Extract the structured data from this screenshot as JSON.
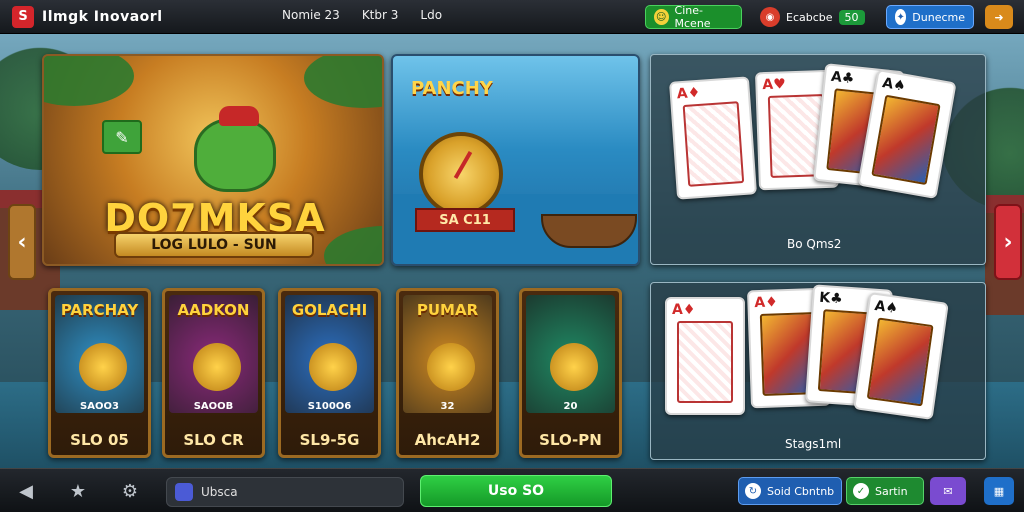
{
  "app": {
    "logo_glyph": "S",
    "title": "Ilmgk Inovaorl"
  },
  "top_links": [
    "Nomie 23",
    "Ktbr 3",
    "Ldo"
  ],
  "top_right": {
    "green_pill": "Cine-Mcene",
    "coins_label": "Ecabcbe",
    "coins_count": "50",
    "blue_pill": "Dunecme"
  },
  "hero": {
    "title": "DO7MKSA",
    "banner": "LOG LULO - SUN"
  },
  "fishing": {
    "top": "PANCHY",
    "ribbon": "SA C11"
  },
  "card_panels": {
    "top_label": "Bo Qms2",
    "bottom_label": "Stags1ml",
    "top_cards": [
      {
        "rank": "A",
        "suit": "♦",
        "color": "red",
        "face": false
      },
      {
        "rank": "A",
        "suit": "♥",
        "color": "red",
        "face": false
      },
      {
        "rank": "A",
        "suit": "♣",
        "color": "blk",
        "face": true
      },
      {
        "rank": "A",
        "suit": "♠",
        "color": "blk",
        "face": true
      }
    ],
    "bottom_cards": [
      {
        "rank": "A",
        "suit": "♦",
        "color": "red",
        "face": false
      },
      {
        "rank": "A",
        "suit": "♦",
        "color": "red",
        "face": true
      },
      {
        "rank": "K",
        "suit": "♣",
        "color": "blk",
        "face": true
      },
      {
        "rank": "A",
        "suit": "♠",
        "color": "blk",
        "face": true
      }
    ]
  },
  "tiles": [
    {
      "name": "PARCHAY",
      "sub": "SAOO3",
      "price": "SLO 05",
      "bg": "#2f8fc4"
    },
    {
      "name": "AADKON",
      "sub": "SAOOB",
      "price": "SLO CR",
      "bg": "#8a2a7a"
    },
    {
      "name": "GOLACHI",
      "sub": "S100O6",
      "price": "SL9-5G",
      "bg": "#2c6fc0"
    },
    {
      "name": "PUMAR",
      "sub": "32",
      "price": "AhcAH2",
      "bg": "#d08a22"
    },
    {
      "name": "",
      "sub": "20",
      "price": "SLO-PN",
      "bg": "#1f8a64"
    }
  ],
  "bottom": {
    "search_label": "Ubsca",
    "play_label": "Uso SO",
    "blue_btn": "Soid Cbntnb",
    "green_btn": "Sartin"
  },
  "colors": {
    "accent_green": "#1b8f2b",
    "accent_blue": "#1f6fc9",
    "accent_red": "#d12a2a",
    "gold": "#ffd33d"
  },
  "icons": {
    "back": "arrow-left-icon",
    "star": "star-icon",
    "settings": "gear-icon",
    "grid": "grid-icon"
  }
}
